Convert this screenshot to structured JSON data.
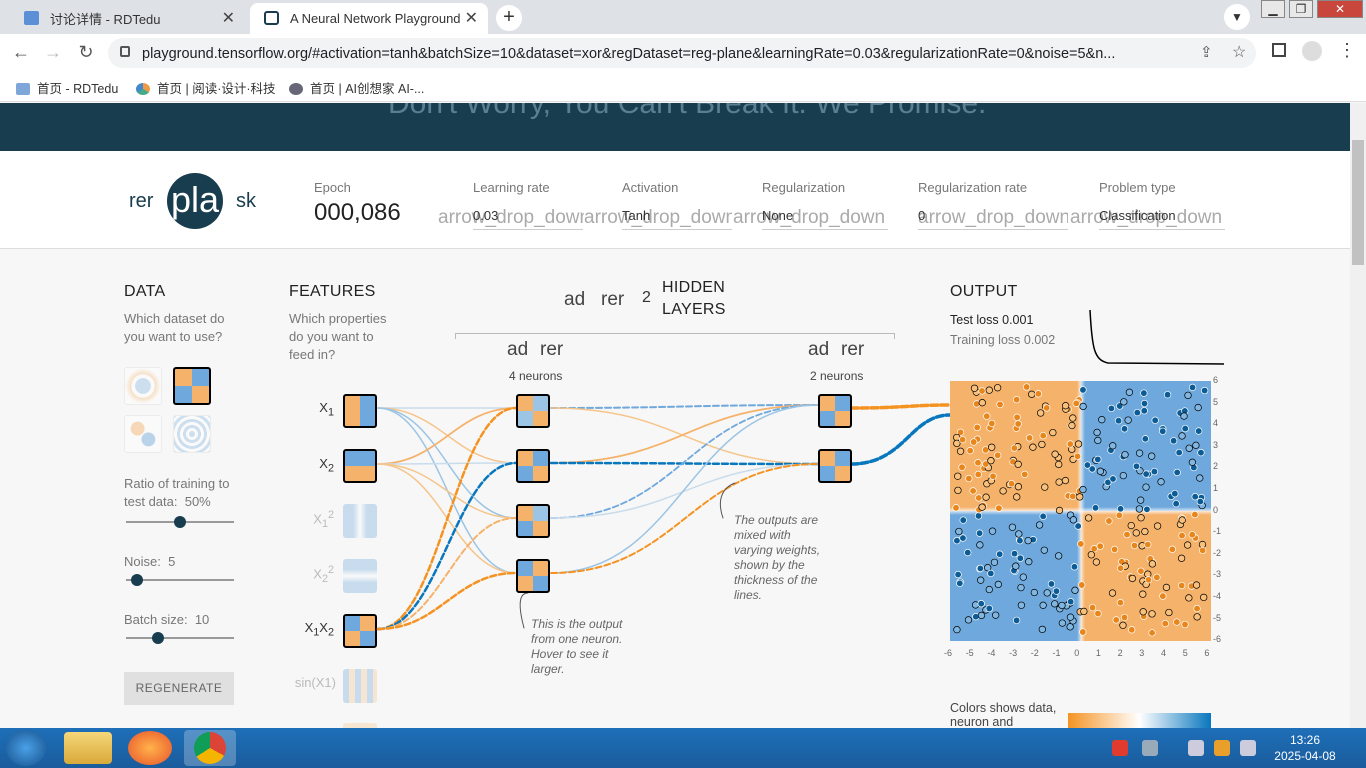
{
  "browser": {
    "tabs": [
      {
        "title": "讨论详情 - RDTedu"
      },
      {
        "title": "A Neural Network Playground"
      }
    ],
    "new_tab": "+",
    "url": "playground.tensorflow.org/#activation=tanh&batchSize=10&dataset=xor&regDataset=reg-plane&learningRate=0.03&regularizationRate=0&noise=5&n...",
    "bookmarks": [
      {
        "label": "首页 - RDTedu"
      },
      {
        "label": "首页 | 阅读·设计·科技"
      },
      {
        "label": "首页 | AI创想家 AI-..."
      }
    ]
  },
  "banner": {
    "text": "Don't Worry, You Can't Break It. We Promise."
  },
  "toolbar": {
    "reset_label": "rer",
    "play_label": "pla",
    "step_label": "sk",
    "epoch_label": "Epoch",
    "epoch_value": "000,086",
    "learning_rate_label": "Learning rate",
    "learning_rate_value": "0.03",
    "activation_label": "Activation",
    "activation_value": "Tanh",
    "regularization_label": "Regularization",
    "regularization_value": "None",
    "reg_rate_label": "Regularization rate",
    "reg_rate_value": "0",
    "problem_label": "Problem type",
    "problem_value": "Classification",
    "dropdown_glyph": "arrow_drop_down"
  },
  "data_panel": {
    "title": "DATA",
    "question": "Which dataset do you want to use?",
    "ratio_label": "Ratio of training to test data:",
    "ratio_value": "50%",
    "ratio": 0.5,
    "noise_label": "Noise:",
    "noise_value": "5",
    "noise": 0.1,
    "batch_label": "Batch size:",
    "batch_value": "10",
    "batch": 0.3,
    "regenerate": "REGENERATE"
  },
  "features": {
    "title": "FEATURES",
    "question": "Which properties do you want to feed in?",
    "items": [
      {
        "label": "X1",
        "sub": "1",
        "sup": ""
      },
      {
        "label": "X2",
        "sub": "2",
        "sup": ""
      },
      {
        "label": "X1",
        "sub": "1",
        "sup": "2"
      },
      {
        "label": "X2",
        "sub": "2",
        "sup": "2"
      },
      {
        "label": "X1X2",
        "sub": "",
        "sup": ""
      },
      {
        "label": "sin(X1)",
        "sub": "",
        "sup": ""
      }
    ]
  },
  "network": {
    "add_glyph": "ad",
    "remove_glyph": "rer",
    "hidden_count": "2",
    "hidden_title": "HIDDEN LAYERS",
    "layer1_neurons": "4 neurons",
    "layer2_neurons": "2 neurons",
    "annotation_neuron": "This is the output from one neuron. Hover to see it larger.",
    "annotation_neuron_bold": "neuron",
    "annotation_weights": "The outputs are mixed with varying weights, shown by the thickness of the lines.",
    "annotation_weights_bold": "weights"
  },
  "output": {
    "title": "OUTPUT",
    "test_loss_label": "Test loss",
    "test_loss_value": "0.001",
    "train_loss_label": "Training loss",
    "train_loss_value": "0.002",
    "colors_note": "Colors shows data, neuron and",
    "y_ticks": [
      "6",
      "5",
      "4",
      "3",
      "2",
      "1",
      "0",
      "-1",
      "-2",
      "-3",
      "-4",
      "-5",
      "-6"
    ],
    "x_ticks": [
      "-6",
      "-5",
      "-4",
      "-3",
      "-2",
      "-1",
      "0",
      "1",
      "2",
      "3",
      "4",
      "5",
      "6"
    ]
  },
  "colors": {
    "orange": "#f59322",
    "blue": "#0877bd",
    "dark": "#183d4e"
  },
  "taskbar": {
    "time": "13:26",
    "date": "2025-04-08"
  }
}
